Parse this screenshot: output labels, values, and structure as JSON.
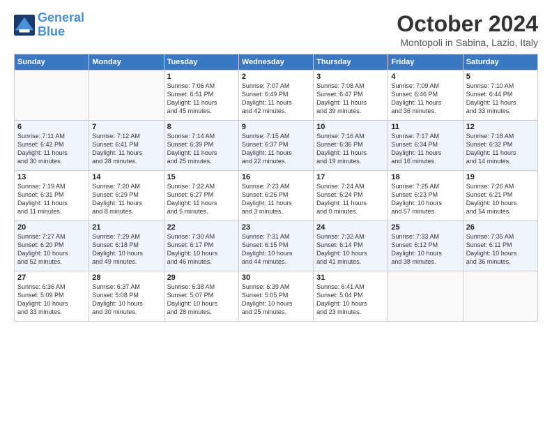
{
  "header": {
    "logo_line1": "General",
    "logo_line2": "Blue",
    "month_title": "October 2024",
    "location": "Montopoli in Sabina, Lazio, Italy"
  },
  "weekdays": [
    "Sunday",
    "Monday",
    "Tuesday",
    "Wednesday",
    "Thursday",
    "Friday",
    "Saturday"
  ],
  "weeks": [
    [
      {
        "day": "",
        "info": ""
      },
      {
        "day": "",
        "info": ""
      },
      {
        "day": "1",
        "info": "Sunrise: 7:06 AM\nSunset: 6:51 PM\nDaylight: 11 hours\nand 45 minutes."
      },
      {
        "day": "2",
        "info": "Sunrise: 7:07 AM\nSunset: 6:49 PM\nDaylight: 11 hours\nand 42 minutes."
      },
      {
        "day": "3",
        "info": "Sunrise: 7:08 AM\nSunset: 6:47 PM\nDaylight: 11 hours\nand 39 minutes."
      },
      {
        "day": "4",
        "info": "Sunrise: 7:09 AM\nSunset: 6:46 PM\nDaylight: 11 hours\nand 36 minutes."
      },
      {
        "day": "5",
        "info": "Sunrise: 7:10 AM\nSunset: 6:44 PM\nDaylight: 11 hours\nand 33 minutes."
      }
    ],
    [
      {
        "day": "6",
        "info": "Sunrise: 7:11 AM\nSunset: 6:42 PM\nDaylight: 11 hours\nand 30 minutes."
      },
      {
        "day": "7",
        "info": "Sunrise: 7:12 AM\nSunset: 6:41 PM\nDaylight: 11 hours\nand 28 minutes."
      },
      {
        "day": "8",
        "info": "Sunrise: 7:14 AM\nSunset: 6:39 PM\nDaylight: 11 hours\nand 25 minutes."
      },
      {
        "day": "9",
        "info": "Sunrise: 7:15 AM\nSunset: 6:37 PM\nDaylight: 11 hours\nand 22 minutes."
      },
      {
        "day": "10",
        "info": "Sunrise: 7:16 AM\nSunset: 6:36 PM\nDaylight: 11 hours\nand 19 minutes."
      },
      {
        "day": "11",
        "info": "Sunrise: 7:17 AM\nSunset: 6:34 PM\nDaylight: 11 hours\nand 16 minutes."
      },
      {
        "day": "12",
        "info": "Sunrise: 7:18 AM\nSunset: 6:32 PM\nDaylight: 11 hours\nand 14 minutes."
      }
    ],
    [
      {
        "day": "13",
        "info": "Sunrise: 7:19 AM\nSunset: 6:31 PM\nDaylight: 11 hours\nand 11 minutes."
      },
      {
        "day": "14",
        "info": "Sunrise: 7:20 AM\nSunset: 6:29 PM\nDaylight: 11 hours\nand 8 minutes."
      },
      {
        "day": "15",
        "info": "Sunrise: 7:22 AM\nSunset: 6:27 PM\nDaylight: 11 hours\nand 5 minutes."
      },
      {
        "day": "16",
        "info": "Sunrise: 7:23 AM\nSunset: 6:26 PM\nDaylight: 11 hours\nand 3 minutes."
      },
      {
        "day": "17",
        "info": "Sunrise: 7:24 AM\nSunset: 6:24 PM\nDaylight: 11 hours\nand 0 minutes."
      },
      {
        "day": "18",
        "info": "Sunrise: 7:25 AM\nSunset: 6:23 PM\nDaylight: 10 hours\nand 57 minutes."
      },
      {
        "day": "19",
        "info": "Sunrise: 7:26 AM\nSunset: 6:21 PM\nDaylight: 10 hours\nand 54 minutes."
      }
    ],
    [
      {
        "day": "20",
        "info": "Sunrise: 7:27 AM\nSunset: 6:20 PM\nDaylight: 10 hours\nand 52 minutes."
      },
      {
        "day": "21",
        "info": "Sunrise: 7:29 AM\nSunset: 6:18 PM\nDaylight: 10 hours\nand 49 minutes."
      },
      {
        "day": "22",
        "info": "Sunrise: 7:30 AM\nSunset: 6:17 PM\nDaylight: 10 hours\nand 46 minutes."
      },
      {
        "day": "23",
        "info": "Sunrise: 7:31 AM\nSunset: 6:15 PM\nDaylight: 10 hours\nand 44 minutes."
      },
      {
        "day": "24",
        "info": "Sunrise: 7:32 AM\nSunset: 6:14 PM\nDaylight: 10 hours\nand 41 minutes."
      },
      {
        "day": "25",
        "info": "Sunrise: 7:33 AM\nSunset: 6:12 PM\nDaylight: 10 hours\nand 38 minutes."
      },
      {
        "day": "26",
        "info": "Sunrise: 7:35 AM\nSunset: 6:11 PM\nDaylight: 10 hours\nand 36 minutes."
      }
    ],
    [
      {
        "day": "27",
        "info": "Sunrise: 6:36 AM\nSunset: 5:09 PM\nDaylight: 10 hours\nand 33 minutes."
      },
      {
        "day": "28",
        "info": "Sunrise: 6:37 AM\nSunset: 5:08 PM\nDaylight: 10 hours\nand 30 minutes."
      },
      {
        "day": "29",
        "info": "Sunrise: 6:38 AM\nSunset: 5:07 PM\nDaylight: 10 hours\nand 28 minutes."
      },
      {
        "day": "30",
        "info": "Sunrise: 6:39 AM\nSunset: 5:05 PM\nDaylight: 10 hours\nand 25 minutes."
      },
      {
        "day": "31",
        "info": "Sunrise: 6:41 AM\nSunset: 5:04 PM\nDaylight: 10 hours\nand 23 minutes."
      },
      {
        "day": "",
        "info": ""
      },
      {
        "day": "",
        "info": ""
      }
    ]
  ]
}
